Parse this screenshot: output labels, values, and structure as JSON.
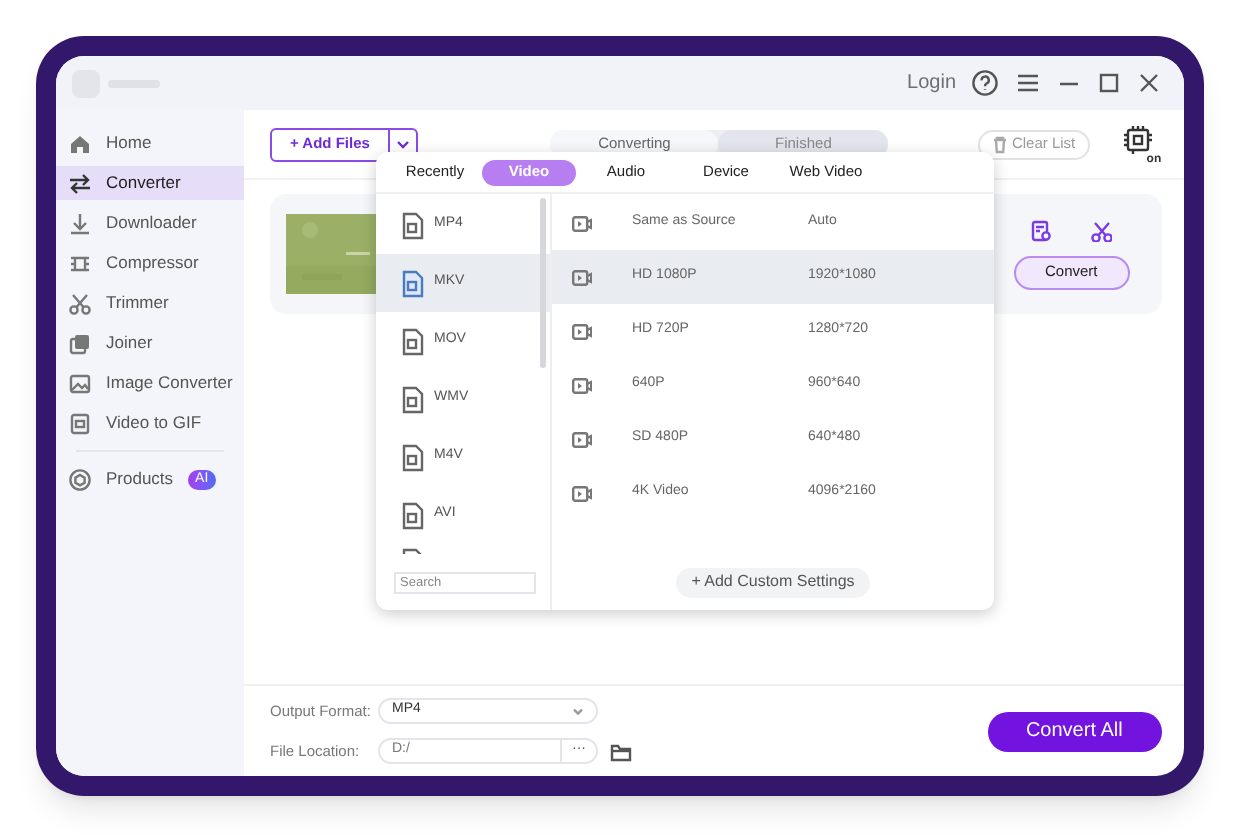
{
  "title_bar": {
    "login": "Login"
  },
  "sidebar": {
    "items": [
      {
        "label": "Home",
        "selected": false
      },
      {
        "label": "Converter",
        "selected": true
      },
      {
        "label": "Downloader",
        "selected": false
      },
      {
        "label": "Compressor",
        "selected": false
      },
      {
        "label": "Trimmer",
        "selected": false
      },
      {
        "label": "Joiner",
        "selected": false
      },
      {
        "label": "Image Converter",
        "selected": false
      },
      {
        "label": "Video to GIF",
        "selected": false
      }
    ],
    "products": {
      "label": "Products",
      "badge": "AI"
    }
  },
  "toolbar": {
    "add_files": "+ Add Files",
    "tabs": [
      {
        "label": "Converting",
        "selected": true
      },
      {
        "label": "Finished",
        "selected": false
      }
    ],
    "clear_list": "Clear List",
    "chip_label": "on"
  },
  "file_card": {
    "convert": "Convert"
  },
  "format_popup": {
    "categories": [
      {
        "label": "Recently",
        "selected": false
      },
      {
        "label": "Video",
        "selected": true
      },
      {
        "label": "Audio",
        "selected": false
      },
      {
        "label": "Device",
        "selected": false
      },
      {
        "label": "Web Video",
        "selected": false
      }
    ],
    "formats": [
      {
        "label": "MP4",
        "selected": false
      },
      {
        "label": "MKV",
        "selected": true
      },
      {
        "label": "MOV",
        "selected": false
      },
      {
        "label": "WMV",
        "selected": false
      },
      {
        "label": "M4V",
        "selected": false
      },
      {
        "label": "AVI",
        "selected": false
      }
    ],
    "search": {
      "placeholder": "Search"
    },
    "presets": [
      {
        "name": "Same as Source",
        "resolution": "Auto",
        "selected": false
      },
      {
        "name": "HD 1080P",
        "resolution": "1920*1080",
        "selected": true
      },
      {
        "name": "HD 720P",
        "resolution": "1280*720",
        "selected": false
      },
      {
        "name": "640P",
        "resolution": "960*640",
        "selected": false
      },
      {
        "name": "SD 480P",
        "resolution": "640*480",
        "selected": false
      },
      {
        "name": "4K Video",
        "resolution": "4096*2160",
        "selected": false
      }
    ],
    "add_custom": "+ Add Custom Settings"
  },
  "bottom_bar": {
    "output_format_label": "Output Format:",
    "output_format": "MP4",
    "file_location_label": "File Location:",
    "file_location": "D:/",
    "browse": "···",
    "convert_all": "Convert All"
  }
}
